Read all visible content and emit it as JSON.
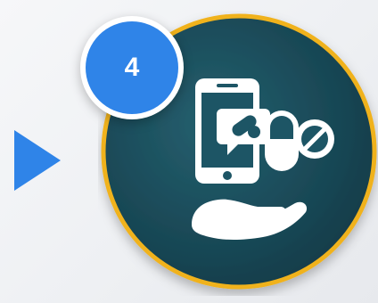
{
  "step": {
    "number": "4"
  },
  "icons": {
    "arrow": "play-triangle-icon",
    "main": "mobile-pharmacy-icon",
    "parts": [
      "smartphone-icon",
      "pill-chat-bubble-icon",
      "capsule-icon",
      "no-pill-icon",
      "open-hand-icon"
    ]
  },
  "colors": {
    "accent_blue": "#2f84e8",
    "disc_teal": "#1b4f5e",
    "ring_gold": "#f0b21d",
    "icon_fill": "#ffffff",
    "background": "#f2f3f5"
  }
}
